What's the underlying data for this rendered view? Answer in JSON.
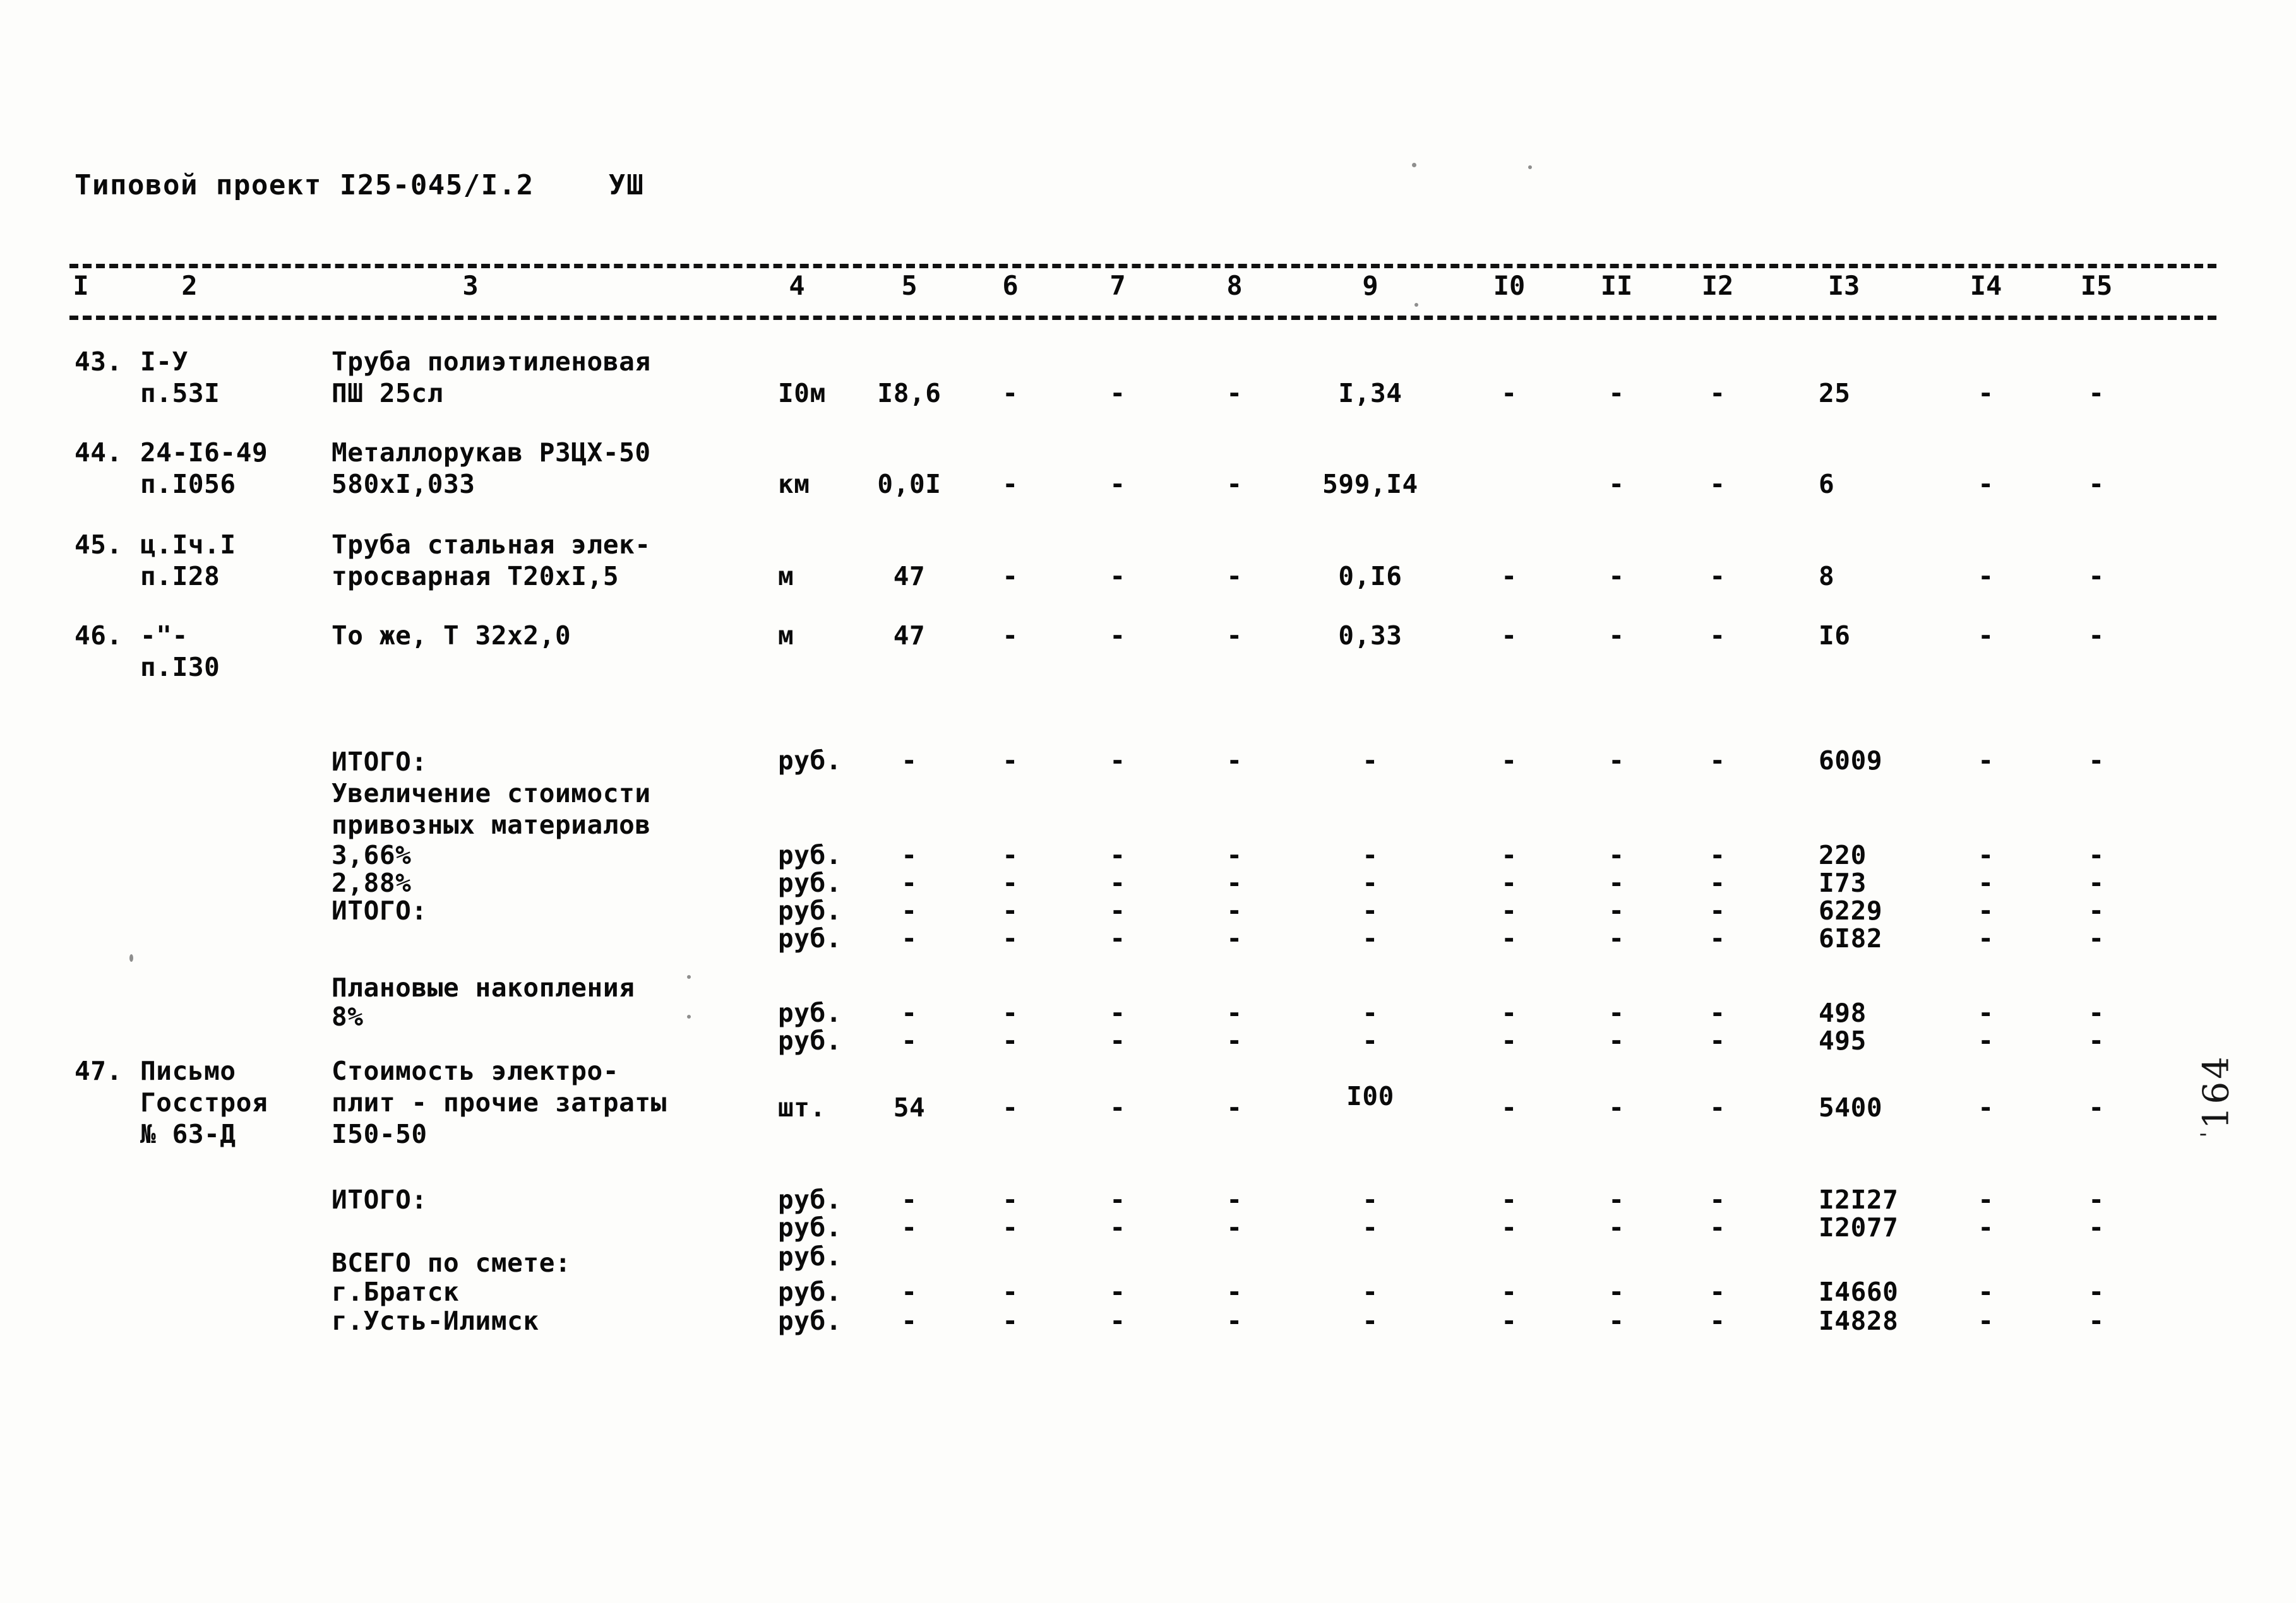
{
  "header": {
    "title": "Типовой проект I25-045/I.2",
    "section": "УШ"
  },
  "columns": {
    "labels": [
      "I",
      "2",
      "3",
      "4",
      "5",
      "6",
      "7",
      "8",
      "9",
      "I0",
      "II",
      "I2",
      "I3",
      "I4",
      "I5"
    ]
  },
  "page_number": {
    "value": "164",
    "tick": "'"
  },
  "dash": "-",
  "rows": [
    {
      "num": "43.",
      "code_line1": "I-У",
      "code_line2": "п.53I",
      "desc_line1": "Труба полиэтиленовая",
      "desc_line2": "ПШ 25сл",
      "unit": "I0м",
      "c5": "I8,6",
      "c6": "-",
      "c7": "-",
      "c8": "-",
      "c9": "I,34",
      "c10": "-",
      "c11": "-",
      "c12": "-",
      "c13": "25",
      "c14": "-",
      "c15": "-"
    },
    {
      "num": "44.",
      "code_line1": "24-I6-49",
      "code_line2": "п.I056",
      "desc_line1": "Металлорукав РЗЦХ-50",
      "desc_line2": "580хI,033",
      "unit": "км",
      "c5": "0,0I",
      "c6": "-",
      "c7": "-",
      "c8": "-",
      "c9": "599,I4",
      "c10": "",
      "c11": "-",
      "c12": "-",
      "c13": "6",
      "c14": "-",
      "c15": "-"
    },
    {
      "num": "45.",
      "code_line1": "ц.Iч.I",
      "code_line2": "п.I28",
      "desc_line1": "Труба стальная элек-",
      "desc_line2": "тросварная Т20хI,5",
      "unit": "м",
      "c5": "47",
      "c6": "-",
      "c7": "-",
      "c8": "-",
      "c9": "0,I6",
      "c10": "-",
      "c11": "-",
      "c12": "-",
      "c13": "8",
      "c14": "-",
      "c15": "-"
    },
    {
      "num": "46.",
      "code_line1": "-\"-",
      "code_line2": "п.I30",
      "desc_line1": "То же, Т 32х2,0",
      "desc_line2": "",
      "unit": "м",
      "c5": "47",
      "c6": "-",
      "c7": "-",
      "c8": "-",
      "c9": "0,33",
      "c10": "-",
      "c11": "-",
      "c12": "-",
      "c13": "I6",
      "c14": "-",
      "c15": "-"
    },
    {
      "num": "47.",
      "code_line1": "Письмо",
      "code_line2": "Госстроя",
      "code_line3": "№ 63-Д",
      "desc_line1": "Стоимость электро-",
      "desc_line2": "плит - прочие затраты",
      "desc_line3": "I50-50",
      "unit": "шт.",
      "c5": "54",
      "c6": "-",
      "c7": "-",
      "c8": "-",
      "c9": "I00",
      "c10": "-",
      "c11": "-",
      "c12": "-",
      "c13": "5400",
      "c14": "-",
      "c15": "-"
    }
  ],
  "totals_block_a": {
    "label_itogo": "ИТОГО:",
    "label_increase_line1": "Увеличение стоимости",
    "label_increase_line2": "привозных материалов",
    "label_pct1": "3,66%",
    "label_pct2": "2,88%",
    "label_itogo2": "ИТОГО:",
    "label_plan_line1": "Плановые накопления",
    "label_plan_line2": "8%",
    "unit": "руб.",
    "values": [
      "6009",
      "220",
      "I73",
      "6229",
      "6I82",
      "498",
      "495"
    ]
  },
  "totals_block_b": {
    "label_itogo": "ИТОГО:",
    "label_vsego": "ВСЕГО по смете:",
    "label_city1": "г.Братск",
    "label_city2": "г.Усть-Илимск",
    "unit": "руб.",
    "values": [
      "I2I27",
      "I2077",
      "I4660",
      "I4828"
    ]
  }
}
